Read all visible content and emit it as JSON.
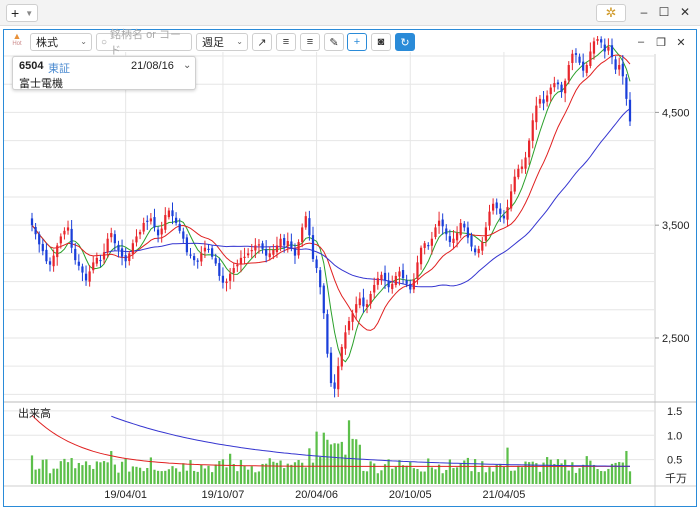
{
  "app": {
    "tab_plus": "+",
    "window": {
      "minimize": "–",
      "maximize": "☐",
      "close": "✕"
    }
  },
  "toolbar": {
    "hot_label": "Hot",
    "market_select": "株式",
    "search_placeholder": "銘柄名 or コード",
    "period_select": "週足",
    "tools": [
      "trend-line",
      "align-left",
      "align-right",
      "draw",
      "crosshair",
      "camera",
      "refresh"
    ]
  },
  "info": {
    "code": "6504",
    "exchange": "東証",
    "date": "21/08/16",
    "name": "富士電機"
  },
  "chart_data": {
    "type": "candlestick",
    "period": "weekly",
    "price_axis": {
      "ticks": [
        "4,500",
        "3,500",
        "2,500"
      ],
      "values": [
        4500,
        3500,
        2500
      ],
      "range": [
        1950,
        5000
      ]
    },
    "volume_panel": {
      "label": "出来高",
      "ticks": [
        "1.5",
        "1.0",
        "0.5"
      ],
      "values": [
        1.5,
        1.0,
        0.5
      ],
      "unit": "千万",
      "range": [
        0,
        1.6
      ]
    },
    "x_ticks": [
      "19/04/01",
      "19/10/07",
      "20/04/06",
      "20/10/05",
      "21/04/05"
    ],
    "colors": {
      "up": "#e8262c",
      "down": "#1a3fd9",
      "ma_short": "#2aa02a",
      "ma_mid": "#e02020",
      "ma_long": "#3535d0",
      "volume": "#5cbf4a"
    },
    "series": [
      {
        "name": "",
        "x_start": "18/10/01",
        "values": [
          3500,
          3420,
          3330,
          3270,
          3180,
          3150,
          3230,
          3320,
          3400,
          3450,
          3480,
          3300,
          3190,
          3140,
          3080,
          3010,
          3090,
          3170,
          3210,
          3190,
          3260,
          3380,
          3430,
          3340,
          3280,
          3220,
          3180,
          3250,
          3340,
          3400,
          3440,
          3520,
          3530,
          3560,
          3480,
          3410,
          3470,
          3590,
          3630,
          3580,
          3520,
          3450,
          3380,
          3260,
          3230,
          3190,
          3180,
          3250,
          3300,
          3280,
          3220,
          3160,
          3050,
          2990,
          3000,
          3070,
          3120,
          3150,
          3210,
          3220,
          3250,
          3280,
          3320,
          3330,
          3290,
          3230,
          3250,
          3280,
          3320,
          3380,
          3320,
          3360,
          3300,
          3230,
          3350,
          3480,
          3580,
          3410,
          3200,
          3120,
          2950,
          2720,
          2360,
          2100,
          2050,
          2250,
          2420,
          2550,
          2650,
          2720,
          2800,
          2850,
          2780,
          2800,
          2890,
          2970,
          3030,
          3060,
          3010,
          2950,
          2980,
          3050,
          3090,
          3030,
          2980,
          2930,
          3020,
          3170,
          3300,
          3340,
          3320,
          3380,
          3480,
          3540,
          3490,
          3420,
          3350,
          3380,
          3430,
          3520,
          3480,
          3390,
          3310,
          3260,
          3290,
          3350,
          3480,
          3620,
          3690,
          3650,
          3600,
          3560,
          3660,
          3800,
          3930,
          4000,
          4020,
          4100,
          4250,
          4430,
          4560,
          4620,
          4580,
          4650,
          4720,
          4760,
          4750,
          4680,
          4780,
          4920,
          5020,
          5010,
          4940,
          4870,
          4920,
          5040,
          5130,
          5150,
          5120,
          5040,
          5080,
          4990,
          4880,
          4920,
          4820,
          4620,
          4420
        ]
      }
    ]
  }
}
